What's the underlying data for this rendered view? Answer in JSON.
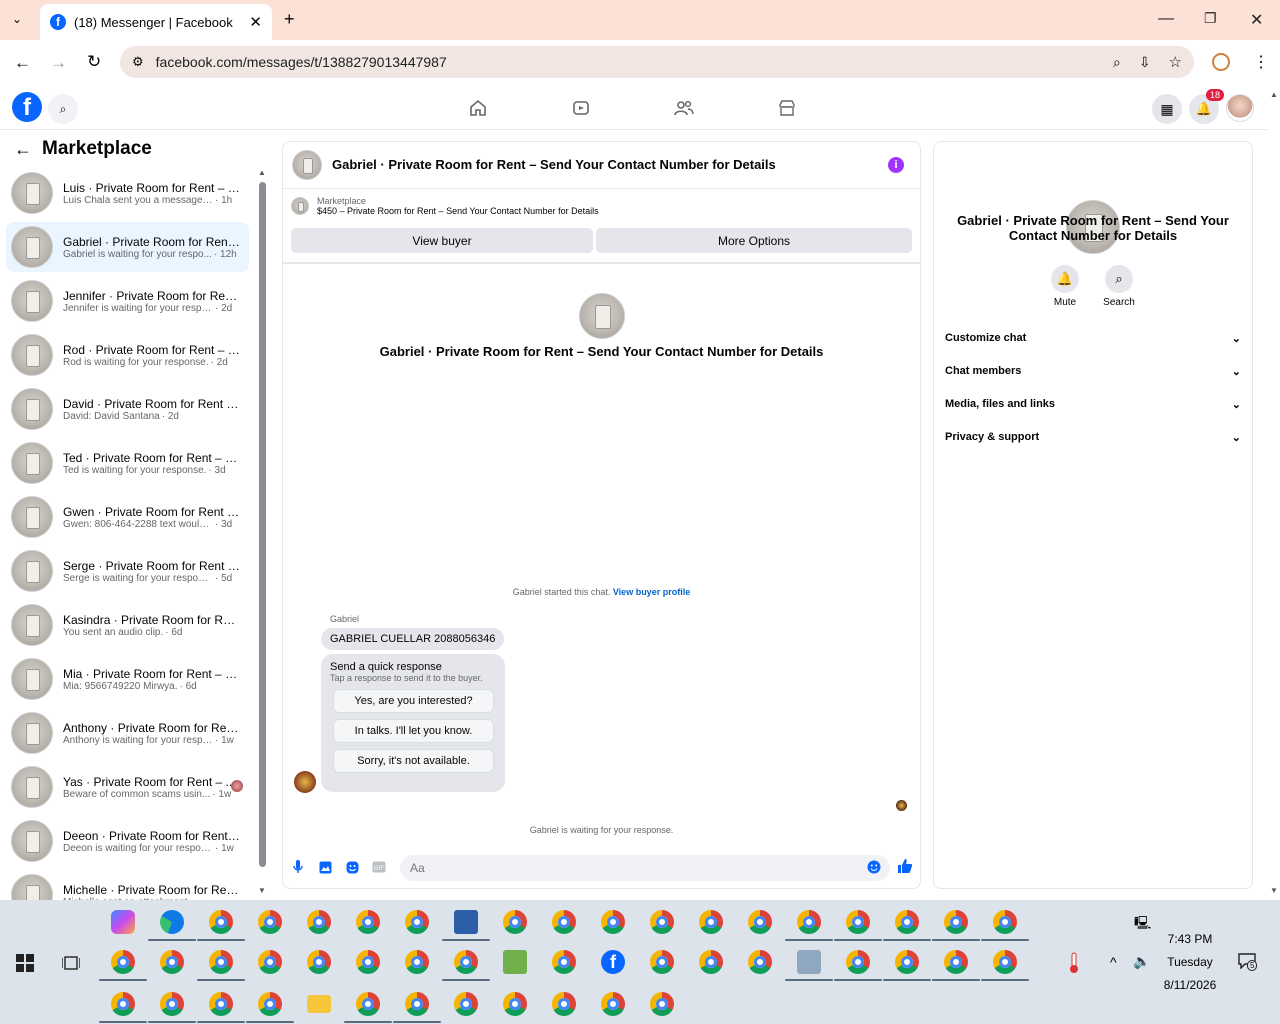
{
  "browser": {
    "tab_title": "(18) Messenger | Facebook",
    "url": "facebook.com/messages/t/1388279013447987",
    "new_tab": "+",
    "tab_close": "✕"
  },
  "fb_header": {
    "notifications_count": "18"
  },
  "sidebar": {
    "title": "Marketplace",
    "conversations": [
      {
        "name": "Luis · Private Room for Rent – S...",
        "preview": "Luis Chala sent you a message ab...",
        "time": "· 1h"
      },
      {
        "name": "Gabriel · Private Room for Rent ...",
        "preview": "Gabriel is waiting for your respo...",
        "time": "· 12h"
      },
      {
        "name": "Jennifer · Private Room for Ren...",
        "preview": "Jennifer is waiting for your respon...",
        "time": "· 2d"
      },
      {
        "name": "Rod · Private Room for Rent – S...",
        "preview": "Rod is waiting for your response.",
        "time": "· 2d"
      },
      {
        "name": "David · Private Room for Rent –...",
        "preview": "David: David Santana",
        "time": "· 2d"
      },
      {
        "name": "Ted · Private Room for Rent – S...",
        "preview": "Ted is waiting for your response.",
        "time": "· 3d"
      },
      {
        "name": "Gwen · Private Room for Rent –...",
        "preview": "Gwen: 806-464-2288 text would b...",
        "time": "· 3d"
      },
      {
        "name": "Serge · Private Room for Rent –...",
        "preview": "Serge is waiting for your response.",
        "time": "· 5d"
      },
      {
        "name": "Kasindra · Private Room for Ren...",
        "preview": "You sent an audio clip.",
        "time": "· 6d"
      },
      {
        "name": "Mia · Private Room for Rent – S...",
        "preview": "Mia: 9566749220 Mirwya.",
        "time": "· 6d"
      },
      {
        "name": "Anthony · Private Room for Ren...",
        "preview": "Anthony is waiting for your respo...",
        "time": "· 1w"
      },
      {
        "name": "Yas · Private Room for Rent – ...",
        "preview": "Beware of common scams usin...",
        "time": "· 1w"
      },
      {
        "name": "Deeon · Private Room for Rent ...",
        "preview": "Deeon is waiting for your response.",
        "time": "· 1w"
      },
      {
        "name": "Michelle · Private Room for Ren...",
        "preview": "Michelle sent an attachment.",
        "time": ""
      }
    ]
  },
  "chat": {
    "header_title": "Gabriel · Private Room for Rent – Send Your Contact Number for Details",
    "marketplace_label": "Marketplace",
    "listing_title": "$450 – Private Room for Rent – Send Your Contact Number for Details",
    "view_buyer": "View buyer",
    "more_options": "More Options",
    "center_name": "Gabriel · Private Room for Rent – Send Your Contact Number for Details",
    "started_text": "Gabriel started this chat.",
    "view_buyer_profile": "View buyer profile",
    "sender_name": "Gabriel",
    "message": "GABRIEL CUELLAR 2088056346",
    "quick_response_title": "Send a quick response",
    "quick_response_sub": "Tap a response to send it to the buyer.",
    "quick_responses": [
      "Yes, are you interested?",
      "In talks. I'll let you know.",
      "Sorry, it's not available."
    ],
    "waiting_text": "Gabriel is waiting for your response.",
    "composer_placeholder": "Aa"
  },
  "right_panel": {
    "name": "Gabriel · Private Room for Rent – Send Your Contact Number for Details",
    "mute": "Mute",
    "search": "Search",
    "sections": [
      "Customize chat",
      "Chat members",
      "Media, files and links",
      "Privacy & support"
    ]
  },
  "taskbar": {
    "time": "7:43 PM",
    "day": "Tuesday",
    "date": "8/11/2026",
    "notification_count": "5"
  },
  "colors": {
    "accent": "#0866ff",
    "active_row": "#ebf5ff",
    "title_bar": "#fbe1d6"
  }
}
